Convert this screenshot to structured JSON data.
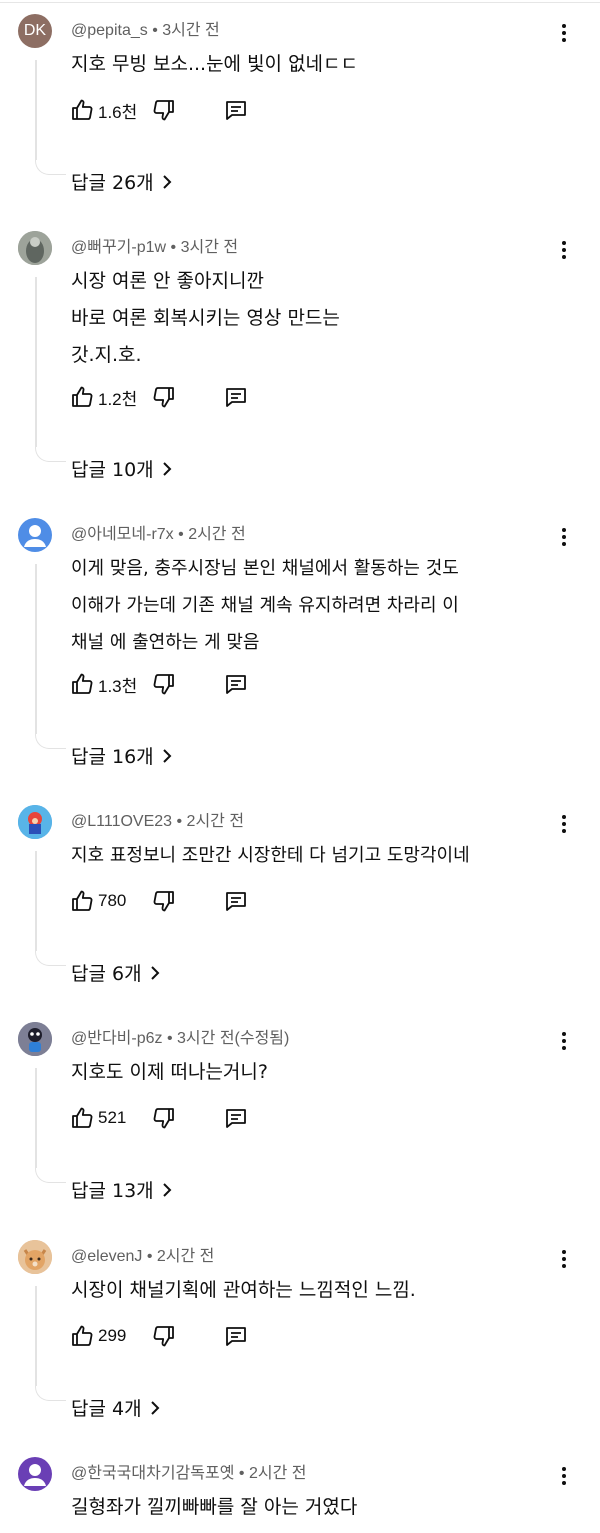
{
  "comments": [
    {
      "author": "@pepita_s",
      "time": "3시간 전",
      "text": [
        "지호 무빙 보소...눈에 빛이 없네ㄷㄷ"
      ],
      "likes": "1.6천",
      "replies": "답글 26개",
      "avatar": {
        "initials": "DK",
        "color": "#8d6e63"
      }
    },
    {
      "author": "@뻐꾸기-p1w",
      "time": "3시간 전",
      "text": [
        "시장 여론 안 좋아지니깐",
        "바로 여론 회복시키는 영상 만드는",
        "갓.지.호."
      ],
      "likes": "1.2천",
      "replies": "답글 10개",
      "avatar": {
        "initials": "",
        "color": "#8a8f86"
      }
    },
    {
      "author": "@아네모네-r7x",
      "time": "2시간 전",
      "text": [
        "이게 맞음, 충주시장님 본인 채널에서 활동하는 것도",
        "이해가 가는데 기존 채널 계속 유지하려면 차라리 이",
        "채널 에 출연하는 게 맞음"
      ],
      "likes": "1.3천",
      "replies": "답글 16개",
      "avatar": {
        "initials": "",
        "color": "#4f8de6"
      }
    },
    {
      "author": "@L111OVE23",
      "time": "2시간 전",
      "text": [
        "지호 표정보니 조만간 시장한테 다 넘기고 도망각이네"
      ],
      "likes": "780",
      "replies": "답글 6개",
      "avatar": {
        "initials": "",
        "color": "#3a9ad9"
      }
    },
    {
      "author": "@반다비-p6z",
      "time": "3시간 전(수정됨)",
      "text": [
        "지호도 이제 떠나는거니?"
      ],
      "likes": "521",
      "replies": "답글 13개",
      "avatar": {
        "initials": "",
        "color": "#6b6f8a"
      }
    },
    {
      "author": "@elevenJ",
      "time": "2시간 전",
      "text": [
        "시장이 채널기획에 관여하는 느낌적인 느낌."
      ],
      "likes": "299",
      "replies": "답글 4개",
      "avatar": {
        "initials": "",
        "color": "#d9a574"
      }
    },
    {
      "author": "@한국국대차기감독포옛",
      "time": "2시간 전",
      "text": [
        "길형좌가 낄끼빠빠를 잘 아는 거였다"
      ],
      "likes": "",
      "replies": "",
      "avatar": {
        "initials": "",
        "color": "#6a3fb5"
      }
    }
  ],
  "icons": {
    "like": "thumb-up-icon",
    "dislike": "thumb-down-icon",
    "reply": "comment-reply-icon",
    "more": "more-vert-icon",
    "chevron": "chevron-right-icon"
  }
}
